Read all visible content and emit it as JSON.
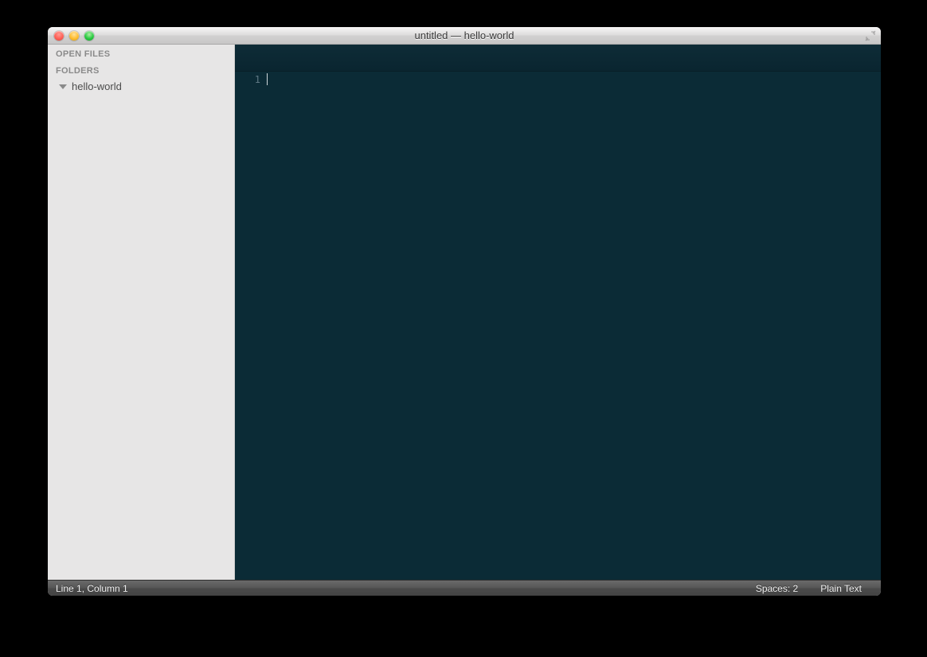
{
  "window": {
    "title": "untitled — hello-world"
  },
  "sidebar": {
    "open_files_header": "OPEN FILES",
    "folders_header": "FOLDERS",
    "folders": [
      {
        "name": "hello-world",
        "expanded": true
      }
    ]
  },
  "editor": {
    "gutter_lines": [
      "1"
    ]
  },
  "status": {
    "position": "Line 1, Column 1",
    "indent": "Spaces: 2",
    "syntax": "Plain Text"
  }
}
